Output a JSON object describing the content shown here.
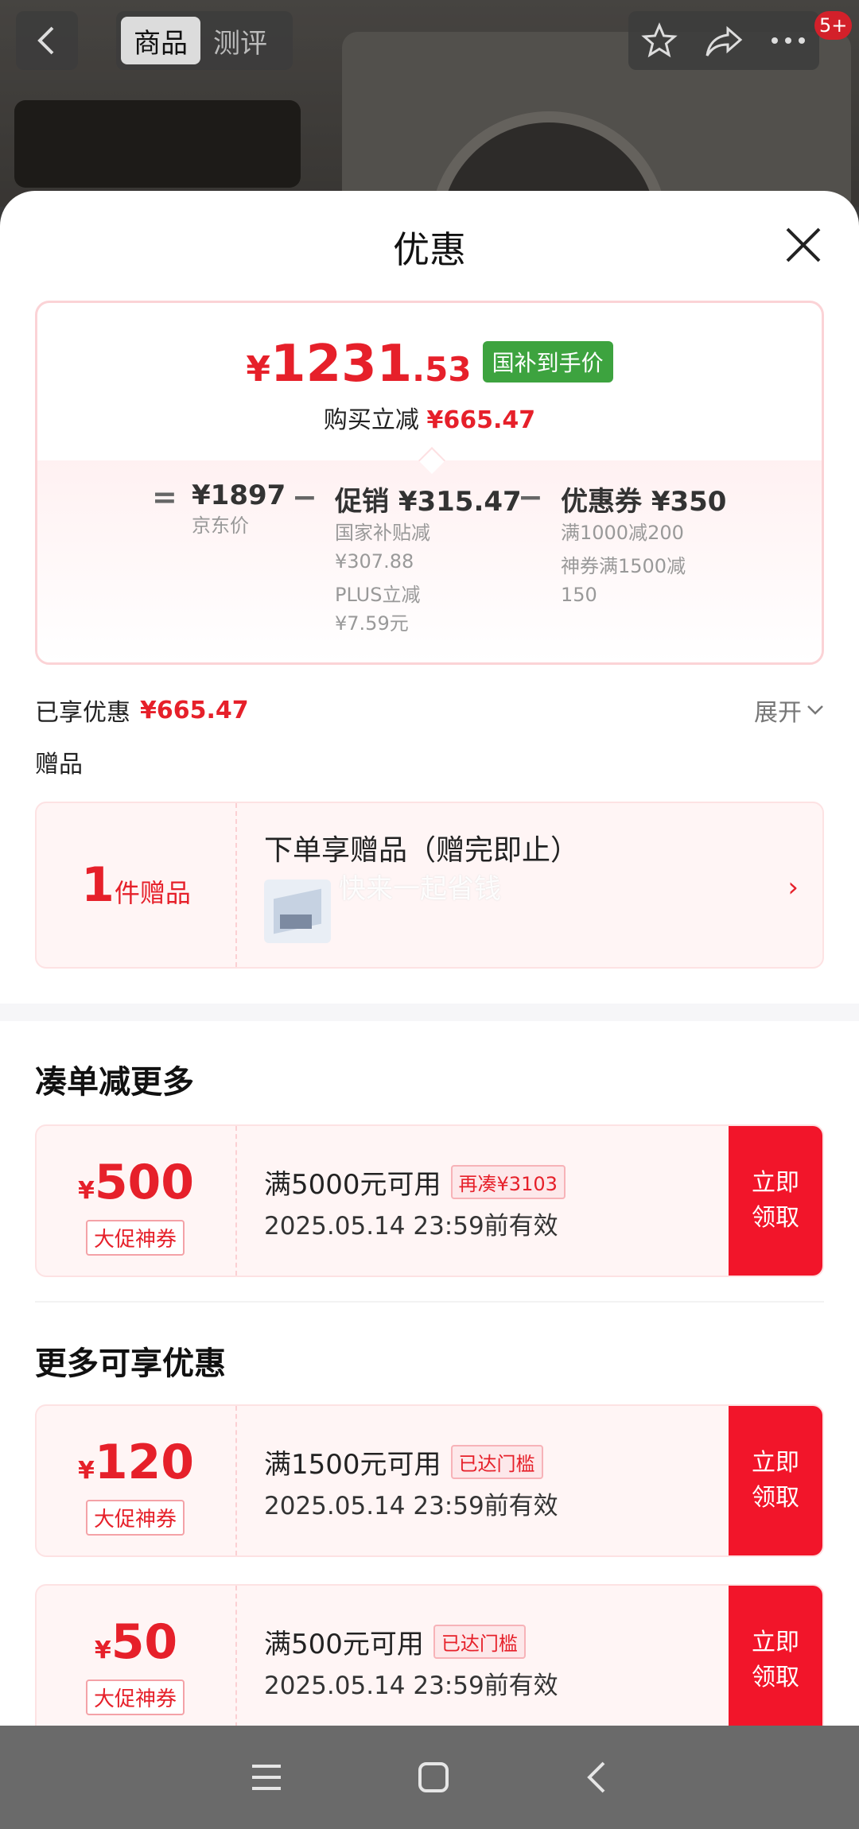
{
  "header": {
    "tabs": [
      {
        "label": "商品"
      },
      {
        "label": "测评"
      }
    ],
    "cart_badge": "5+"
  },
  "sheet": {
    "title": "优惠",
    "final_price": {
      "yen": "¥",
      "integer": "1231",
      "decimal": ".53",
      "tag": "国补到手价"
    },
    "savings": {
      "label": "购买立减",
      "value": "¥665.47"
    },
    "breakdown": {
      "eq": "=",
      "jd_price": {
        "value": "¥1897",
        "label": "京东价"
      },
      "minus": "−",
      "promo": {
        "title": "促销 ¥315.47",
        "lines": [
          "国家补贴减",
          "¥307.88",
          "PLUS立减",
          "¥7.59元"
        ]
      },
      "coupon": {
        "title": "优惠券 ¥350",
        "lines": [
          "满1000减200",
          "神券满1500减",
          "150"
        ]
      }
    },
    "enjoyed": {
      "label": "已享优惠",
      "value": "¥665.47",
      "expand": "展开"
    },
    "gift": {
      "header": "赠品",
      "count": "1",
      "unit": "件赠品",
      "title": "下单享赠品（赠完即止）",
      "watermark": "快来一起省钱"
    },
    "sections": {
      "more_order": "凑单减更多",
      "more_offers": "更多可享优惠"
    },
    "coupons": [
      {
        "yen": "¥",
        "amount": "500",
        "kind": "大促神券",
        "condition": "满5000元可用",
        "tag": "再凑¥3103",
        "expiry": "2025.05.14 23:59前有效",
        "button": "立即\n领取"
      },
      {
        "yen": "¥",
        "amount": "120",
        "kind": "大促神券",
        "condition": "满1500元可用",
        "tag": "已达门槛",
        "expiry": "2025.05.14 23:59前有效",
        "button": "立即\n领取"
      },
      {
        "yen": "¥",
        "amount": "50",
        "kind": "大促神券",
        "condition": "满500元可用",
        "tag": "已达门槛",
        "expiry": "2025.05.14 23:59前有效",
        "button": "立即\n领取"
      }
    ]
  },
  "colors": {
    "accent_red": "#e6202a",
    "button_red": "#f2152a",
    "green_tag": "#3da33f"
  }
}
